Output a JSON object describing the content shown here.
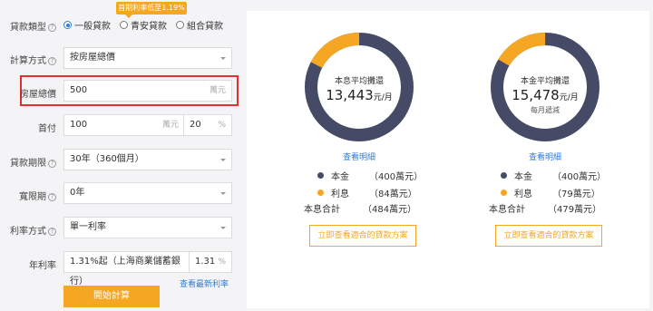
{
  "promo_badge": "首期利率低至1.19%",
  "colors": {
    "accent": "#f5a623",
    "navy": "#454a66",
    "link": "#2f7bd6",
    "highlight": "#e03030"
  },
  "form": {
    "loan_type": {
      "label": "貸款類型",
      "options": [
        "一般貸款",
        "青安貸款",
        "組合貸款"
      ],
      "selected": "一般貸款"
    },
    "calc_method": {
      "label": "計算方式",
      "value": "按房屋總價"
    },
    "house_price": {
      "label": "房屋總價",
      "value": "500",
      "unit": "萬元"
    },
    "down_payment": {
      "label": "首付",
      "value": "100",
      "unit": "萬元",
      "percent": "20",
      "percent_unit": "%"
    },
    "loan_term": {
      "label": "貸款期限",
      "value": "30年（360個月）"
    },
    "grace_period": {
      "label": "寬限期",
      "value": "0年"
    },
    "rate_method": {
      "label": "利率方式",
      "value": "單一利率"
    },
    "annual_rate": {
      "label": "年利率",
      "value": "1.31%起（上海商業儲蓄銀行）",
      "rate": "1.31",
      "rate_unit": "%"
    },
    "view_latest_rates": "查看最新利率",
    "calc_button": "開始計算"
  },
  "results": [
    {
      "title": "本息平均攤還",
      "amount": "13,443",
      "amount_unit": "元/月",
      "sub": "",
      "interest_fraction": 0.174,
      "details_link": "查看明細",
      "principal_label": "本金",
      "principal_value": "（400萬元）",
      "interest_label": "利息",
      "interest_value": "（84萬元）",
      "total_label": "本息合計",
      "total_value": "（484萬元）",
      "cta": "立即查看適合的貸款方案"
    },
    {
      "title": "本金平均攤還",
      "amount": "15,478",
      "amount_unit": "元/月",
      "sub": "每月遞減",
      "interest_fraction": 0.165,
      "details_link": "查看明細",
      "principal_label": "本金",
      "principal_value": "（400萬元）",
      "interest_label": "利息",
      "interest_value": "（79萬元）",
      "total_label": "本息合計",
      "total_value": "（479萬元）",
      "cta": "立即查看適合的貸款方案"
    }
  ]
}
